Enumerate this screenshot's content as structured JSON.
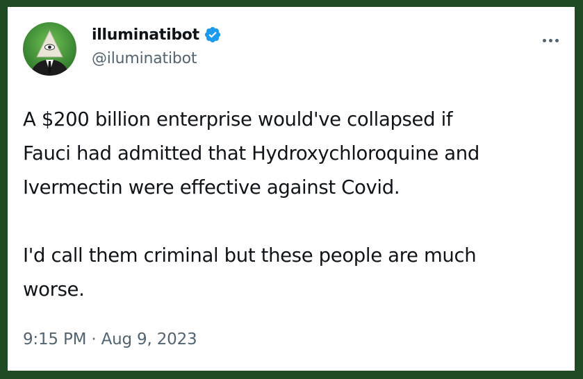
{
  "user": {
    "display_name": "illuminatibot",
    "handle": "@iluminatibot",
    "verified": true,
    "avatar_icon": "pyramid-eye-suit-avatar"
  },
  "tweet": {
    "lines_para1": [
      "A $200 billion enterprise would've collapsed if",
      "Fauci had admitted that Hydroxychloroquine and",
      "Ivermectin were effective against Covid."
    ],
    "lines_para2": [
      "I'd call them criminal but these people are much",
      "worse."
    ],
    "time": "9:15 PM",
    "separator": " · ",
    "date": "Aug 9, 2023"
  },
  "icons": {
    "more": "more-options-icon",
    "verified": "verified-badge-icon"
  },
  "colors": {
    "frame": "#1f4a24",
    "card": "#ffffff",
    "text": "#0f1419",
    "muted": "#536471",
    "verified": "#1d9bf0",
    "avatar_bg": "#3f8f3a"
  }
}
